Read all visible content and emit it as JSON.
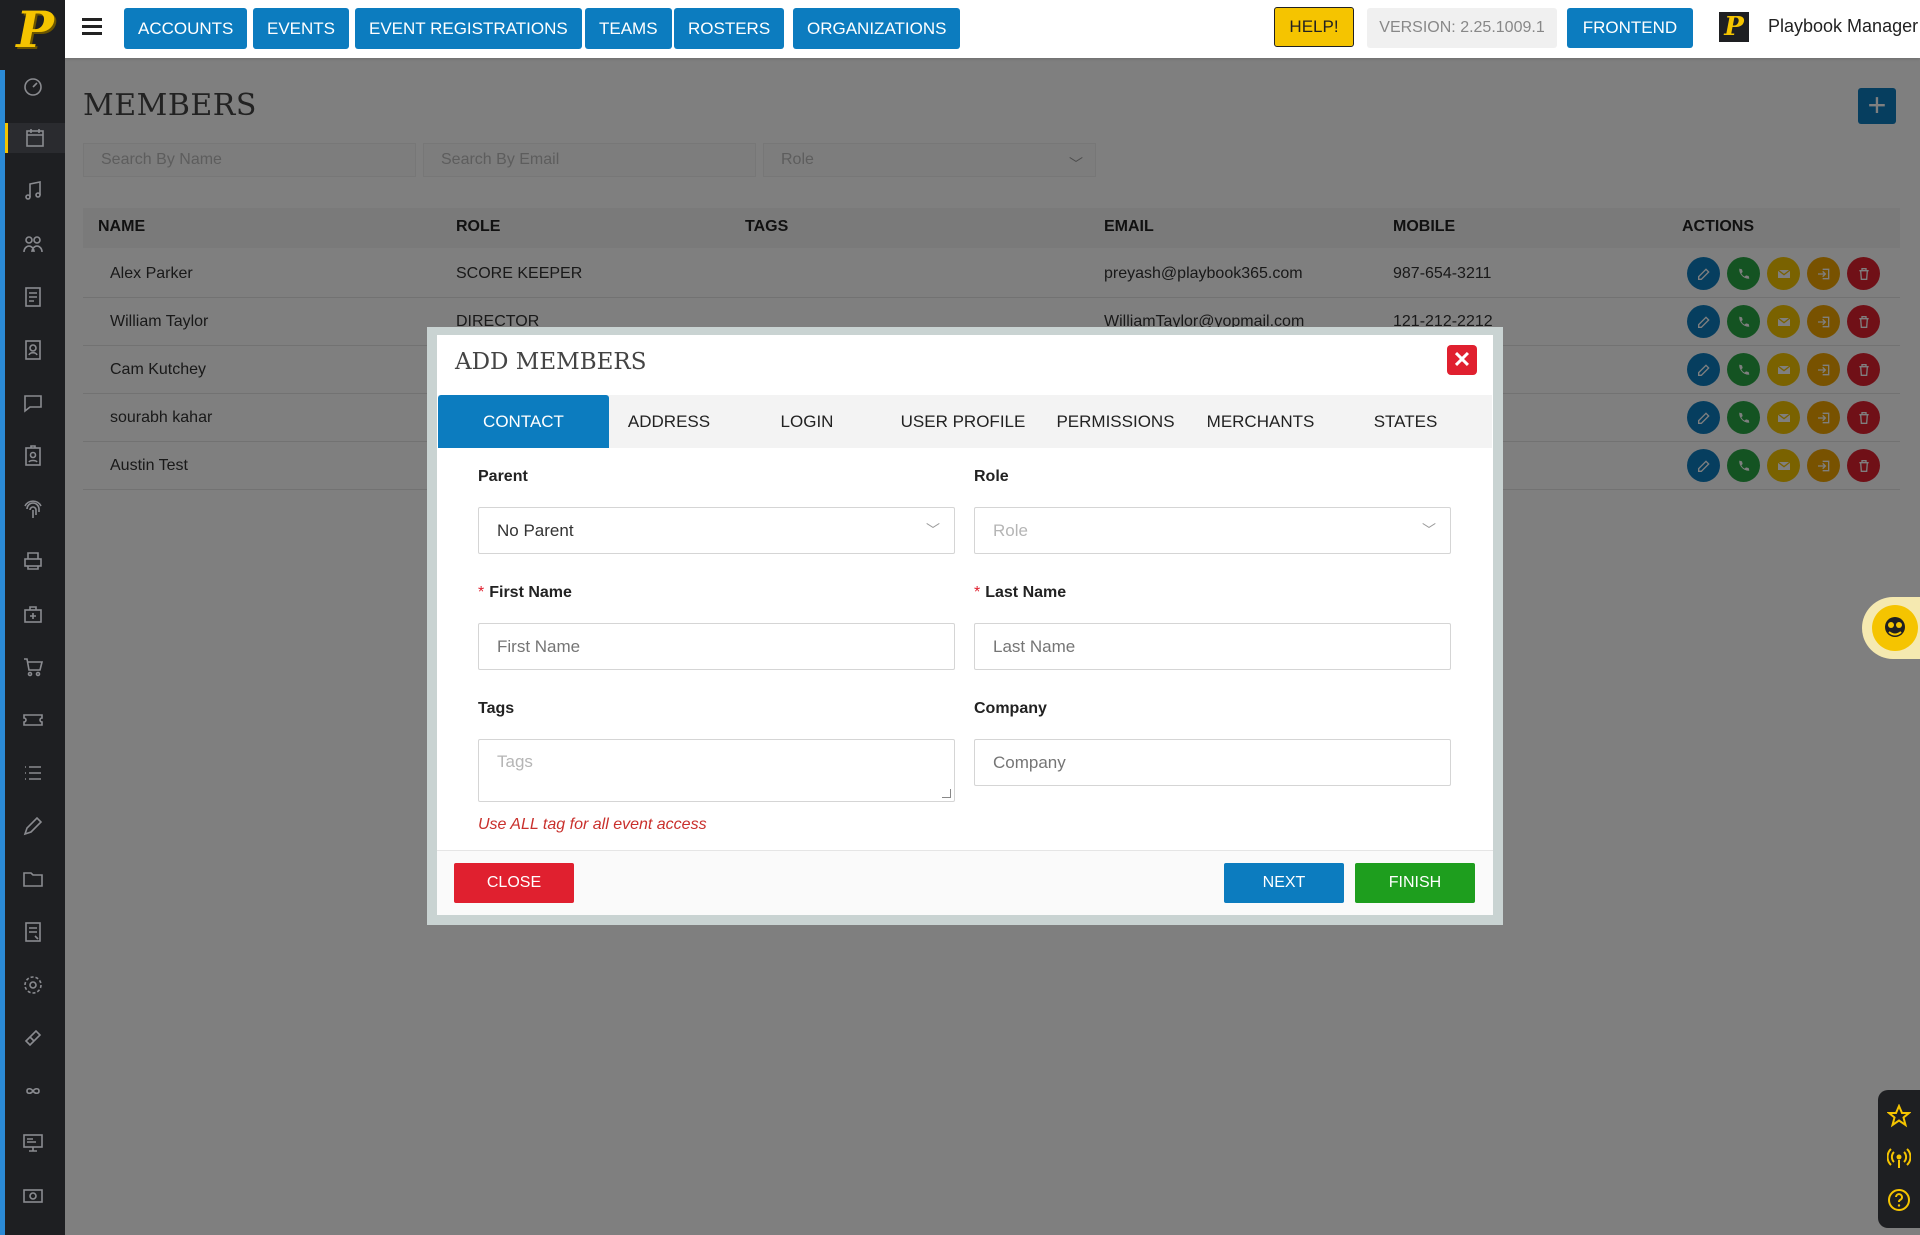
{
  "brand": {
    "logo_letter": "P",
    "accent": "#f5c400",
    "primary": "#0c7cbf"
  },
  "sidebar": {
    "items": [
      {
        "icon": "dashboard-icon"
      },
      {
        "icon": "calendar-icon"
      },
      {
        "icon": "music-note-icon"
      },
      {
        "icon": "users-group-icon"
      },
      {
        "icon": "document-icon"
      },
      {
        "icon": "contact-book-icon"
      },
      {
        "icon": "chat-icon"
      },
      {
        "icon": "id-badge-icon"
      },
      {
        "icon": "fingerprint-icon"
      },
      {
        "icon": "printer-icon"
      },
      {
        "icon": "package-icon"
      },
      {
        "icon": "cart-icon"
      },
      {
        "icon": "ticket-icon"
      },
      {
        "icon": "list-icon"
      },
      {
        "icon": "pencil-icon"
      },
      {
        "icon": "folder-icon"
      },
      {
        "icon": "notes-icon"
      },
      {
        "icon": "gear-icon"
      },
      {
        "icon": "ticket-diagonal-icon"
      },
      {
        "icon": "infinity-icon"
      },
      {
        "icon": "monitor-icon"
      },
      {
        "icon": "money-icon"
      }
    ]
  },
  "topnav": {
    "items": [
      "ACCOUNTS",
      "EVENTS",
      "EVENT REGISTRATIONS",
      "TEAMS",
      "ROSTERS",
      "ORGANIZATIONS"
    ],
    "help": "HELP!",
    "version": "VERSION: 2.25.1009.1",
    "frontend": "FRONTEND",
    "user_name": "Playbook Manager"
  },
  "page": {
    "title": "MEMBERS",
    "add_label": "+",
    "filters": {
      "name_placeholder": "Search By Name",
      "email_placeholder": "Search By Email",
      "role_placeholder": "Role"
    },
    "table": {
      "columns": [
        "NAME",
        "ROLE",
        "TAGS",
        "EMAIL",
        "MOBILE",
        "ACTIONS"
      ],
      "rows": [
        {
          "name": "Alex Parker",
          "role": "SCORE KEEPER",
          "tags": "",
          "email": "preyash@playbook365.com",
          "mobile": "987-654-3211"
        },
        {
          "name": "William Taylor",
          "role": "DIRECTOR",
          "tags": "",
          "email": "WilliamTaylor@yopmail.com",
          "mobile": "121-212-2212"
        },
        {
          "name": "Cam Kutchey",
          "role": "",
          "tags": "",
          "email": "",
          "mobile": ""
        },
        {
          "name": "sourabh kahar",
          "role": "",
          "tags": "",
          "email": "",
          "mobile": ""
        },
        {
          "name": "Austin Test",
          "role": "",
          "tags": "",
          "email": "",
          "mobile": ""
        }
      ]
    }
  },
  "modal": {
    "title": "ADD MEMBERS",
    "tabs": [
      "CONTACT",
      "ADDRESS",
      "LOGIN",
      "USER PROFILE",
      "PERMISSIONS",
      "MERCHANTS",
      "STATES"
    ],
    "active_tab": "CONTACT",
    "fields": {
      "parent": {
        "label": "Parent",
        "value": "No Parent"
      },
      "role": {
        "label": "Role",
        "placeholder": "Role"
      },
      "first_name": {
        "label": "First Name",
        "required_mark": "*",
        "placeholder": "First Name"
      },
      "last_name": {
        "label": "Last Name",
        "required_mark": "*",
        "placeholder": "Last Name"
      },
      "tags": {
        "label": "Tags",
        "placeholder": "Tags"
      },
      "company": {
        "label": "Company",
        "placeholder": "Company"
      }
    },
    "hint": "Use ALL tag for all event access",
    "buttons": {
      "close": "CLOSE",
      "next": "NEXT",
      "finish": "FINISH"
    }
  }
}
